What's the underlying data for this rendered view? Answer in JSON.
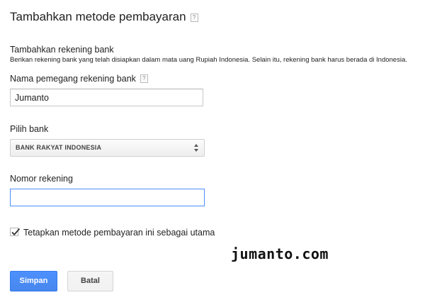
{
  "page": {
    "title": "Tambahkan metode pembayaran",
    "help_glyph": "?"
  },
  "section": {
    "title": "Tambahkan rekening bank",
    "description": "Berikan rekening bank yang telah disiapkan dalam mata uang Rupiah Indonesia. Selain itu, rekening bank harus berada di Indonesia."
  },
  "form": {
    "holder": {
      "label": "Nama pemegang rekening bank",
      "help_glyph": "?",
      "value": "Jumanto"
    },
    "bank": {
      "label": "Pilih bank",
      "selected": "BANK RAKYAT INDONESIA"
    },
    "account": {
      "label": "Nomor rekening",
      "value": ""
    },
    "primary": {
      "label": "Tetapkan metode pembayaran ini sebagai utama",
      "checked": true
    }
  },
  "watermark": "jumanto.com",
  "buttons": {
    "save": "Simpan",
    "cancel": "Batal"
  },
  "colors": {
    "primary_button": "#4d90fe",
    "focus_border": "#4d90fe"
  }
}
